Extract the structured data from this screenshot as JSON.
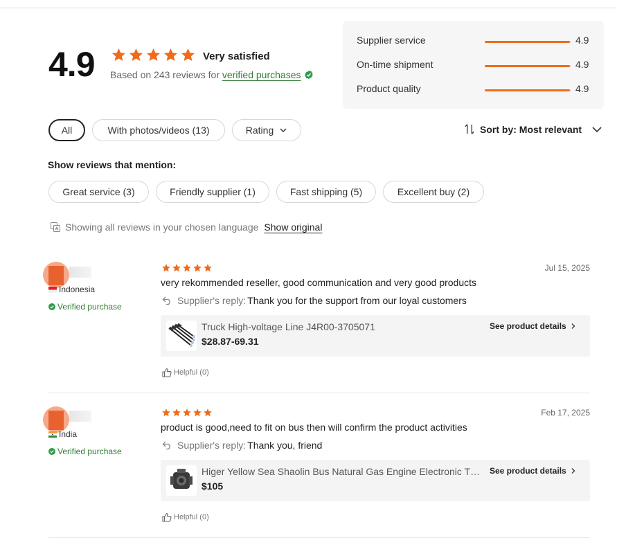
{
  "summary": {
    "rating": "4.9",
    "satisfaction": "Very satisfied",
    "based_on_prefix": "Based on 243 reviews for ",
    "verified_link": "verified purchases",
    "star_color": "#f06a1a",
    "scores": [
      {
        "label": "Supplier service",
        "value": "4.9",
        "fill": 0.98
      },
      {
        "label": "On-time shipment",
        "value": "4.9",
        "fill": 0.98
      },
      {
        "label": "Product quality",
        "value": "4.9",
        "fill": 0.98
      }
    ]
  },
  "filters": {
    "all": "All",
    "photos": "With photos/videos (13)",
    "rating": "Rating",
    "sort": "Sort by: Most relevant"
  },
  "mentions": {
    "title": "Show reviews that mention:",
    "tags": [
      "Great service (3)",
      "Friendly supplier (1)",
      "Fast shipping (5)",
      "Excellent buy (2)"
    ]
  },
  "language": {
    "note": "Showing all reviews in your chosen language",
    "show_original": "Show original"
  },
  "reviews": [
    {
      "country": "Indonesia",
      "verified": "Verified purchase",
      "stars": 5,
      "date": "Jul 15, 2025",
      "text": "very rekommended reseller, good communication and very good products",
      "reply_label": "Supplier's reply:",
      "reply_text": "Thank you for the support from our loyal customers",
      "product_title": "Truck High-voltage Line J4R00-3705071",
      "product_price": "$28.87-69.31",
      "product_link": "See product details",
      "helpful": "Helpful (0)"
    },
    {
      "country": "India",
      "verified": "Verified purchase",
      "stars": 5,
      "date": "Feb 17, 2025",
      "text": "product is good,need to fit on bus then will confirm the product activities",
      "reply_label": "Supplier's reply:",
      "reply_text": "Thank you, friend",
      "product_title": "Higer Yellow Sea Shaolin Bus Natural Gas Engine Electronic Throttle Valve",
      "product_price": "$105",
      "product_link": "See product details",
      "helpful": "Helpful (0)"
    }
  ]
}
